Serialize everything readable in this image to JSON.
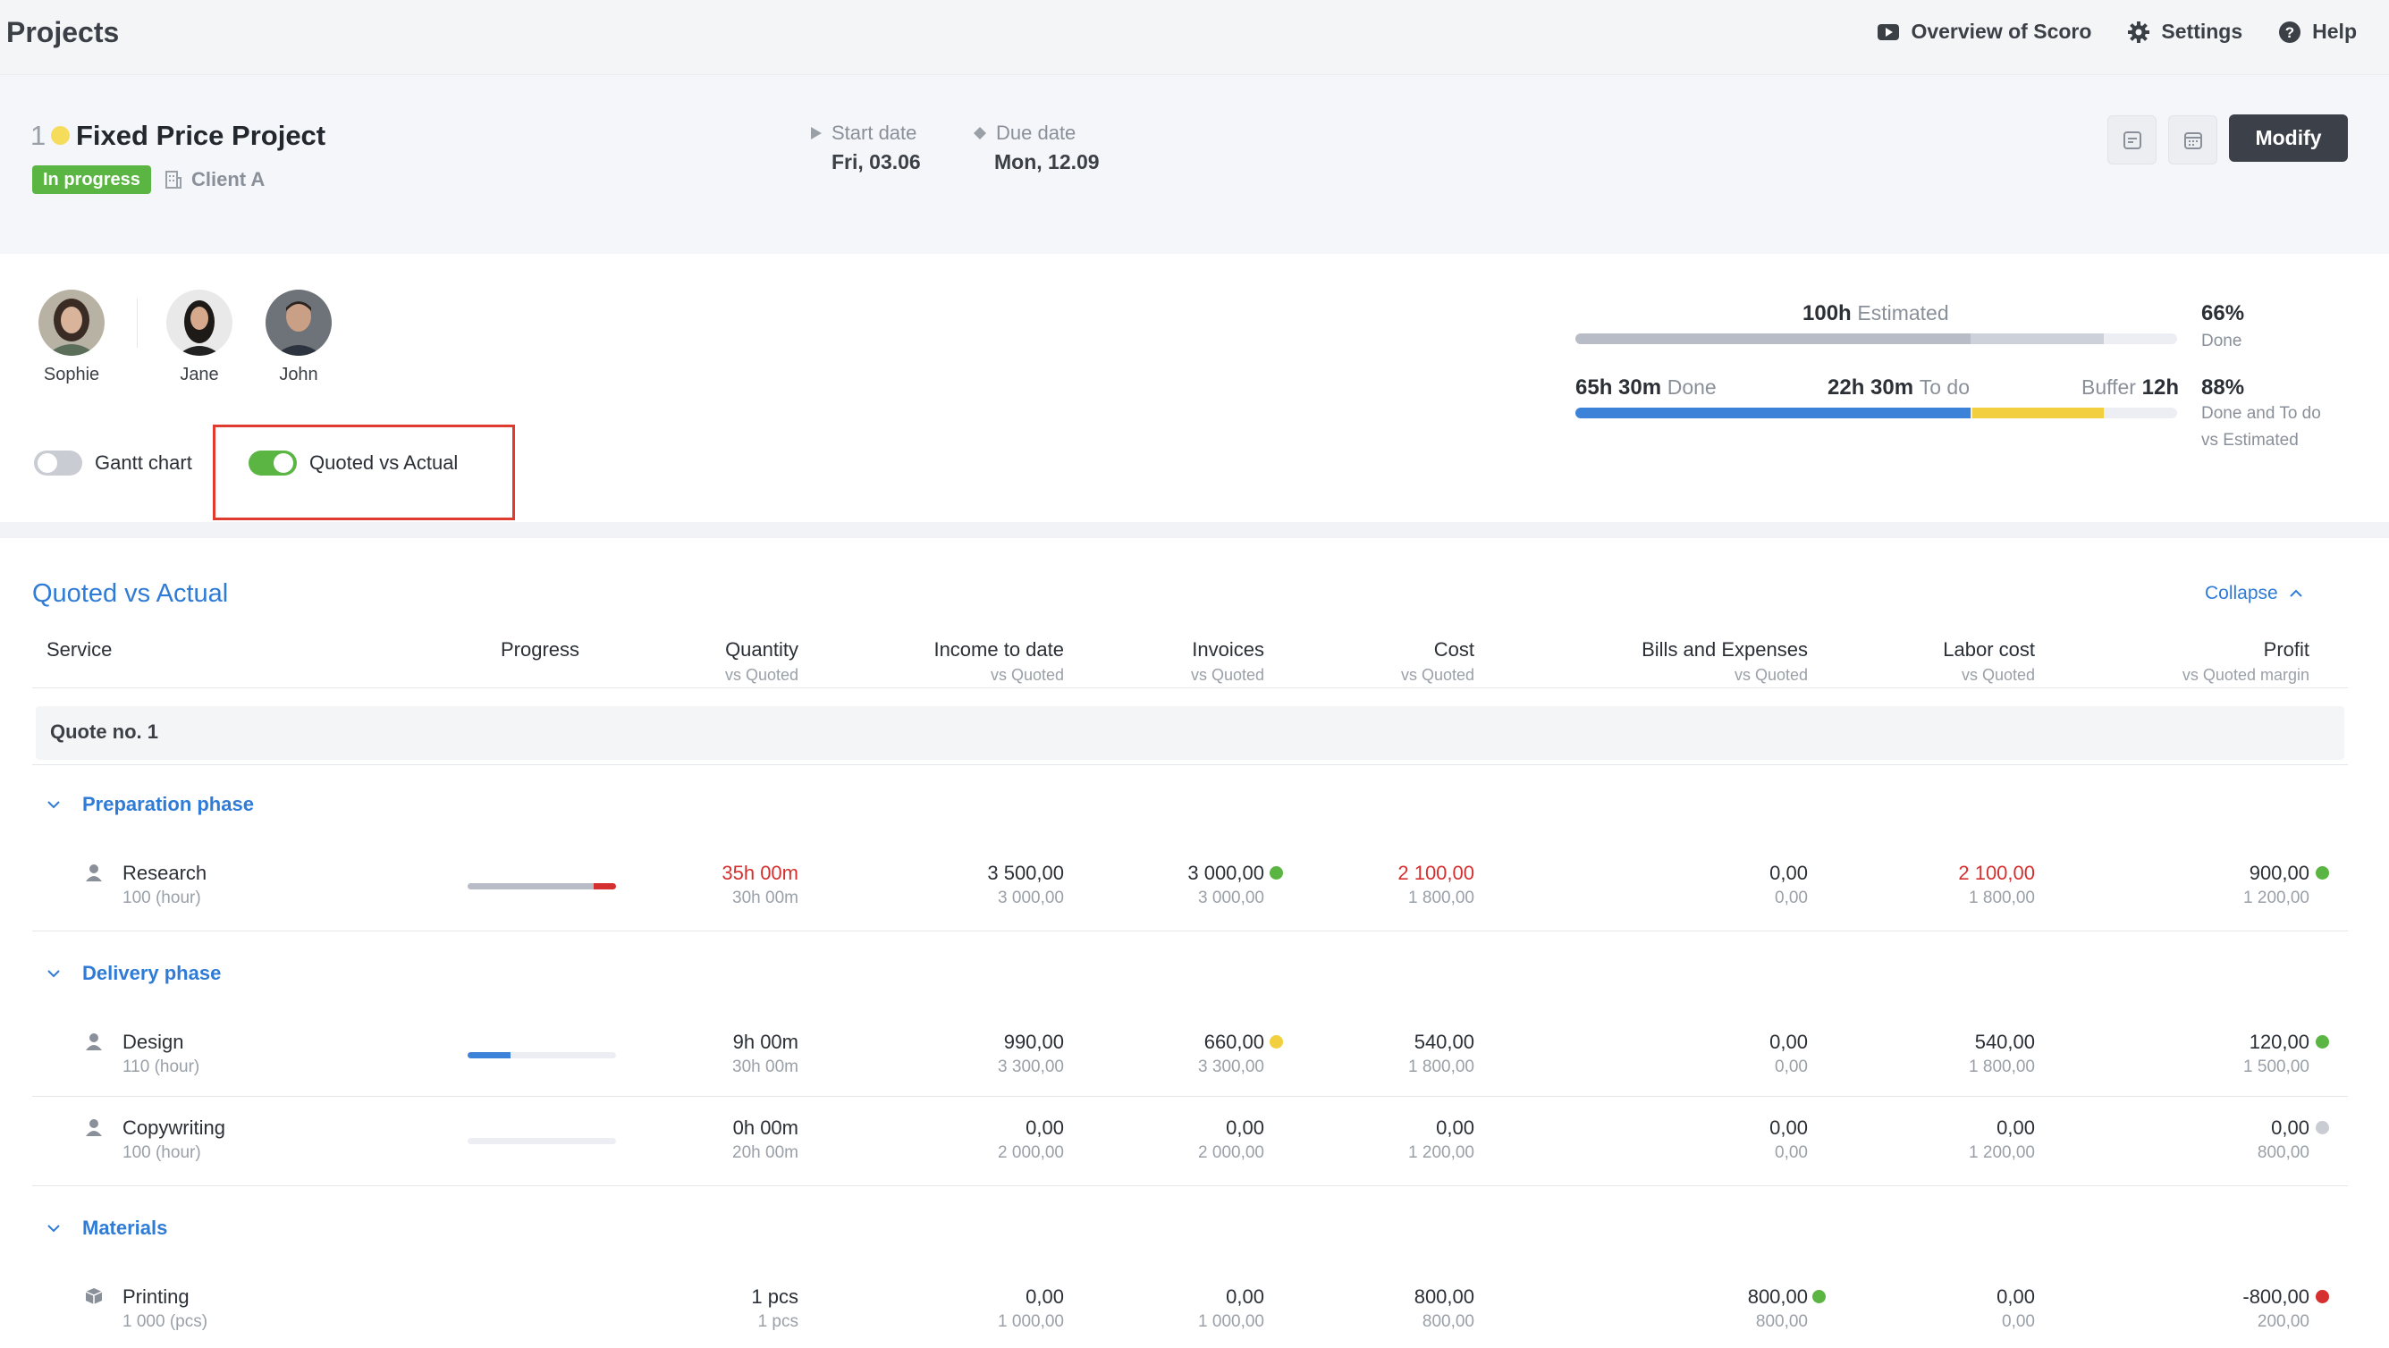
{
  "topbar": {
    "title": "Projects",
    "actions": [
      {
        "label": "Overview of Scoro",
        "icon": "video-play-icon"
      },
      {
        "label": "Settings",
        "icon": "gear-icon"
      },
      {
        "label": "Help",
        "icon": "help-circle-icon"
      }
    ]
  },
  "project": {
    "number": "1",
    "name": "Fixed Price Project",
    "status": "In progress",
    "client": "Client A",
    "start_label": "Start date",
    "start_value": "Fri, 03.06",
    "due_label": "Due date",
    "due_value": "Mon, 12.09",
    "modify_label": "Modify",
    "colors": {
      "status": "#5bb543",
      "dot": "#f5dc5b",
      "modify_bg": "#3c4048"
    }
  },
  "team": [
    {
      "name": "Sophie"
    },
    {
      "name": "Jane"
    },
    {
      "name": "John"
    }
  ],
  "toggles": {
    "gantt": {
      "label": "Gantt chart",
      "on": false
    },
    "qva": {
      "label": "Quoted vs Actual",
      "on": true
    }
  },
  "hours": {
    "estimated_value": "100h",
    "estimated_label": "Estimated",
    "done_value": "65h 30m",
    "done_label": "Done",
    "todo_value": "22h 30m",
    "todo_label": "To do",
    "buffer_label": "Buffer",
    "buffer_value": "12h",
    "pct_done": "66%",
    "pct_done_label": "Done",
    "pct_done_todo": "88%",
    "pct_done_todo_label_1": "Done and To do",
    "pct_done_todo_label_2": "vs Estimated"
  },
  "qva": {
    "title": "Quoted vs Actual",
    "collapse_label": "Collapse",
    "columns": {
      "service": "Service",
      "progress": "Progress",
      "quantity": "Quantity",
      "quantity_sub": "vs Quoted",
      "income": "Income to date",
      "income_sub": "vs Quoted",
      "invoices": "Invoices",
      "invoices_sub": "vs Quoted",
      "cost": "Cost",
      "cost_sub": "vs Quoted",
      "bills": "Bills and Expenses",
      "bills_sub": "vs Quoted",
      "labor": "Labor cost",
      "labor_sub": "vs Quoted",
      "profit": "Profit",
      "profit_sub": "vs Quoted margin"
    },
    "quote_label": "Quote no. 1",
    "phases": [
      {
        "name": "Preparation phase"
      },
      {
        "name": "Delivery phase"
      },
      {
        "name": "Materials"
      }
    ],
    "rows": [
      {
        "name": "Research",
        "unit": "100 (hour)",
        "icon": "person-icon",
        "progress": 1.0,
        "quantity": "35h 00m",
        "quantity_q": "30h 00m",
        "income": "3 500,00",
        "income_q": "3 000,00",
        "invoices": "3 000,00",
        "invoices_q": "3 000,00",
        "cost": "2 100,00",
        "cost_q": "1 800,00",
        "bills": "0,00",
        "bills_q": "0,00",
        "labor": "2 100,00",
        "labor_q": "1 800,00",
        "profit": "900,00",
        "profit_q": "1 200,00"
      },
      {
        "name": "Design",
        "unit": "110 (hour)",
        "icon": "person-icon",
        "progress": 0.3,
        "quantity": "9h 00m",
        "quantity_q": "30h 00m",
        "income": "990,00",
        "income_q": "3 300,00",
        "invoices": "660,00",
        "invoices_q": "3 300,00",
        "cost": "540,00",
        "cost_q": "1 800,00",
        "bills": "0,00",
        "bills_q": "0,00",
        "labor": "540,00",
        "labor_q": "1 800,00",
        "profit": "120,00",
        "profit_q": "1 500,00"
      },
      {
        "name": "Copywriting",
        "unit": "100 (hour)",
        "icon": "person-icon",
        "progress": 0,
        "quantity": "0h 00m",
        "quantity_q": "20h 00m",
        "income": "0,00",
        "income_q": "2 000,00",
        "invoices": "0,00",
        "invoices_q": "2 000,00",
        "cost": "0,00",
        "cost_q": "1 200,00",
        "bills": "0,00",
        "bills_q": "0,00",
        "labor": "0,00",
        "labor_q": "1 200,00",
        "profit": "0,00",
        "profit_q": "800,00"
      },
      {
        "name": "Printing",
        "unit": "1 000 (pcs)",
        "icon": "box-icon",
        "quantity": "1 pcs",
        "quantity_q": "1 pcs",
        "income": "0,00",
        "income_q": "1 000,00",
        "invoices": "0,00",
        "invoices_q": "1 000,00",
        "cost": "800,00",
        "cost_q": "800,00",
        "bills": "800,00",
        "bills_q": "800,00",
        "labor": "0,00",
        "labor_q": "0,00",
        "profit": "-800,00",
        "profit_q": "200,00"
      }
    ],
    "colors": {
      "link": "#2f7bd6",
      "over": "#d62f2f",
      "good": "#5bb543",
      "warn": "#f2cf3e",
      "neutral": "#c9ccd2",
      "bad": "#d62f2f"
    }
  }
}
